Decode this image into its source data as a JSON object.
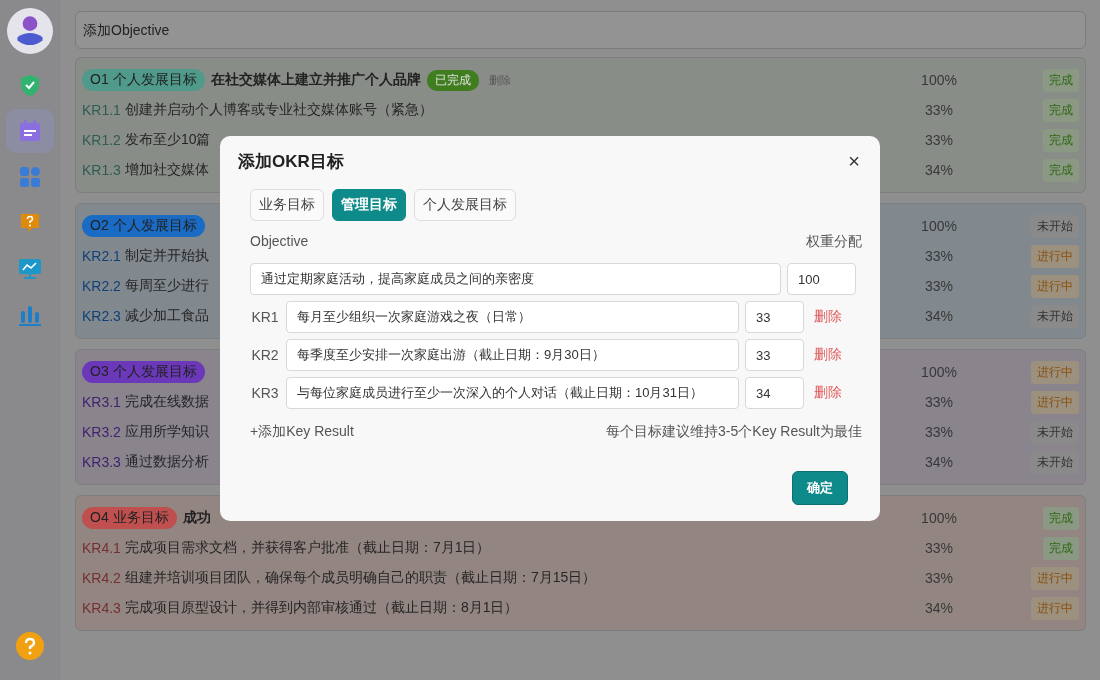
{
  "sidebar": {
    "items": [
      {
        "kind": "shield",
        "selected": false
      },
      {
        "kind": "calendar",
        "selected": true
      },
      {
        "kind": "grid",
        "selected": false
      },
      {
        "kind": "question",
        "selected": false
      },
      {
        "kind": "monitor",
        "selected": false
      },
      {
        "kind": "bars",
        "selected": false
      }
    ]
  },
  "add_objective": {
    "placeholder": "添加Objective"
  },
  "objectives": [
    {
      "tag": "O1 个人发展目标",
      "color": "#4f9a8a",
      "title": "在社交媒体上建立并推广个人品牌",
      "completed_badge": "已完成",
      "delete": "删除",
      "percent": "100%",
      "status": {
        "kind": "done",
        "text": "完成"
      },
      "key_results": [
        {
          "code": "KR1.1",
          "text": "创建并启动个人博客或专业社交媒体账号（紧急）",
          "percent": "33%",
          "status": {
            "kind": "done",
            "text": "完成"
          }
        },
        {
          "code": "KR1.2",
          "text": "发布至少10篇",
          "percent": "33%",
          "status": {
            "kind": "done",
            "text": "完成"
          }
        },
        {
          "code": "KR1.3",
          "text": "增加社交媒体",
          "percent": "34%",
          "status": {
            "kind": "done",
            "text": "完成"
          }
        }
      ]
    },
    {
      "tag": "O2 个人发展目标",
      "color": "#1a6bc4",
      "percent": "100%",
      "status": {
        "kind": "todo",
        "text": "未开始"
      },
      "key_results": [
        {
          "code": "KR2.1",
          "text": "制定并开始执",
          "percent": "33%",
          "status": {
            "kind": "doing",
            "text": "进行中"
          }
        },
        {
          "code": "KR2.2",
          "text": "每周至少进行",
          "percent": "33%",
          "status": {
            "kind": "doing",
            "text": "进行中"
          }
        },
        {
          "code": "KR2.3",
          "text": "减少加工食品",
          "percent": "34%",
          "status": {
            "kind": "todo",
            "text": "未开始"
          }
        }
      ]
    },
    {
      "tag": "O3 个人发展目标",
      "color": "#6a38b8",
      "percent": "100%",
      "status": {
        "kind": "doing",
        "text": "进行中"
      },
      "key_results": [
        {
          "code": "KR3.1",
          "text": "完成在线数据",
          "percent": "33%",
          "status": {
            "kind": "doing",
            "text": "进行中"
          }
        },
        {
          "code": "KR3.2",
          "text": "应用所学知识",
          "percent": "33%",
          "status": {
            "kind": "todo",
            "text": "未开始"
          }
        },
        {
          "code": "KR3.3",
          "text": "通过数据分析",
          "percent": "34%",
          "status": {
            "kind": "todo",
            "text": "未开始"
          }
        }
      ]
    },
    {
      "tag": "O4 业务目标",
      "color": "#c0504f",
      "title": "成功",
      "percent": "100%",
      "status": {
        "kind": "done",
        "text": "完成"
      },
      "key_results": [
        {
          "code": "KR4.1",
          "text": "完成项目需求文档，并获得客户批准（截止日期：7月1日）",
          "percent": "33%",
          "status": {
            "kind": "done",
            "text": "完成"
          }
        },
        {
          "code": "KR4.2",
          "text": "组建并培训项目团队，确保每个成员明确自己的职责（截止日期：7月15日）",
          "percent": "33%",
          "status": {
            "kind": "doing",
            "text": "进行中"
          }
        },
        {
          "code": "KR4.3",
          "text": "完成项目原型设计，并得到内部审核通过（截止日期：8月1日）",
          "percent": "34%",
          "status": {
            "kind": "doing",
            "text": "进行中"
          }
        }
      ]
    }
  ],
  "dialog": {
    "title": "添加OKR目标",
    "close": "×",
    "tabs": [
      {
        "label": "业务目标",
        "selected": false
      },
      {
        "label": "管理目标",
        "selected": true
      },
      {
        "label": "个人发展目标",
        "selected": false
      }
    ],
    "objective_label": "Objective",
    "weight_label": "权重分配",
    "objective": {
      "value": "通过定期家庭活动，提高家庭成员之间的亲密度",
      "weight": "100"
    },
    "key_results": [
      {
        "label": "KR1",
        "value": "每月至少组织一次家庭游戏之夜（日常）",
        "weight": "33",
        "delete": "删除"
      },
      {
        "label": "KR2",
        "value": "每季度至少安排一次家庭出游（截止日期：9月30日）",
        "weight": "33",
        "delete": "删除"
      },
      {
        "label": "KR3",
        "value": "与每位家庭成员进行至少一次深入的个人对话（截止日期：10月31日）",
        "weight": "34",
        "delete": "删除"
      }
    ],
    "add_key_result": "+添加Key Result",
    "hint": "每个目标建议维持3-5个Key Result为最佳",
    "confirm": "确定"
  }
}
